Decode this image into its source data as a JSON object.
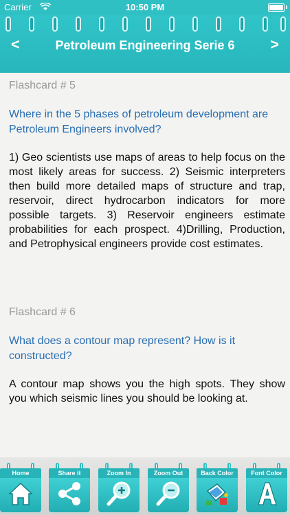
{
  "status": {
    "carrier": "Carrier",
    "time": "10:50 PM"
  },
  "header": {
    "title": "Petroleum Engineering Serie 6",
    "prev": "<",
    "next": ">"
  },
  "cards": [
    {
      "label": "Flashcard # 5",
      "question": "Where in the 5 phases of petroleum development are Petroleum Engineers involved?",
      "answer": "1) Geo scientists use maps of areas to help focus on the most likely areas for success. 2) Seismic interpreters then build more detailed maps of structure and trap, reservoir, direct hydrocarbon indicators for more possible targets. 3) Reservoir engineers estimate probabilities for each prospect. 4)Drilling, Production, and Petrophysical engineers provide cost estimates."
    },
    {
      "label": "Flashcard # 6",
      "question": "What does a contour map represent? How is it constructed?",
      "answer": "A contour map shows you the high spots. They show you which seismic lines you should be looking at."
    }
  ],
  "toolbar": [
    {
      "label": "Home",
      "icon": "home-icon"
    },
    {
      "label": "Share it",
      "icon": "share-icon"
    },
    {
      "label": "Zoom In",
      "icon": "zoom-in-icon"
    },
    {
      "label": "Zoom Out",
      "icon": "zoom-out-icon"
    },
    {
      "label": "Back Color",
      "icon": "paint-bucket-icon"
    },
    {
      "label": "Font Color",
      "icon": "font-a-icon"
    }
  ],
  "colors": {
    "accent": "#2fc0c4",
    "question": "#2a6fb3",
    "label": "#9a9a9a"
  }
}
